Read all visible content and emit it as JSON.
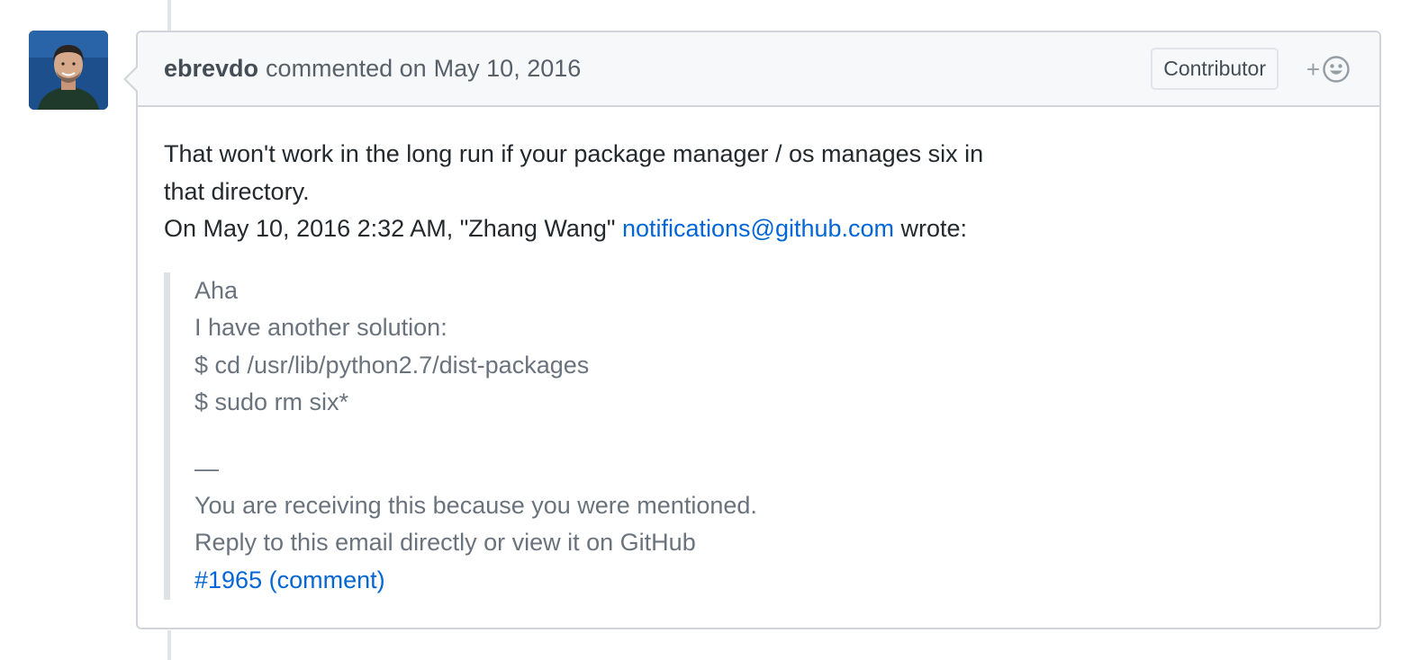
{
  "comment": {
    "author": "ebrevdo",
    "action_text": "commented on",
    "timestamp": "May 10, 2016",
    "badge": "Contributor",
    "reaction_plus": "+",
    "reaction_icon": "smiley-icon",
    "body": {
      "line1": "That won't work in the long run if your package manager / os manages six in",
      "line2": "that directory.",
      "line3_prefix": "On May 10, 2016 2:32 AM, \"Zhang Wang\" ",
      "line3_email": "notifications@github.com",
      "line3_suffix": " wrote:"
    },
    "quote": {
      "lines": [
        "Aha",
        "I have another solution:",
        "$ cd /usr/lib/python2.7/dist-packages",
        "$ sudo rm six*"
      ],
      "separator": "—",
      "footer_lines": [
        "You are receiving this because you were mentioned.",
        "Reply to this email directly or view it on GitHub"
      ],
      "link": "#1965 (comment)"
    }
  },
  "colors": {
    "link": "#0366d6",
    "border": "#d1d5da",
    "header_bg": "#f6f8fa",
    "quote_text": "#6a737d"
  }
}
